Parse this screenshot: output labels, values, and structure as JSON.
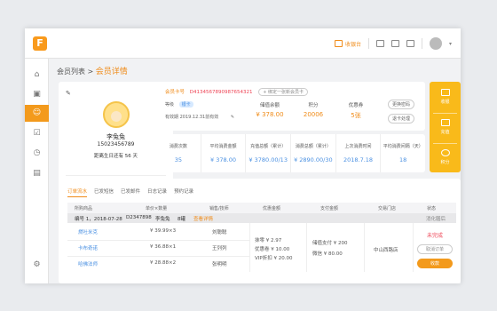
{
  "topbar": {
    "logo": "F",
    "cashier": "收银台"
  },
  "breadcrumb": {
    "parent": "会员列表",
    "sep": ">",
    "current": "会员详情"
  },
  "profile": {
    "name": "李兔兔",
    "phone": "15023456789",
    "note": "距离生日还有 56 天"
  },
  "info": {
    "card_label": "会员卡号",
    "card_number": "D4134567890987654321",
    "bind_tag": "+ 绑定一张新会员卡",
    "level_label": "等级",
    "level": "银卡",
    "expiry_label": "有效期",
    "expiry": "2019.12.31前有效",
    "stats": [
      {
        "label": "储值余额",
        "value": "¥ 378.00"
      },
      {
        "label": "积分",
        "value": "20006"
      },
      {
        "label": "优惠券",
        "value": "5张"
      }
    ],
    "buttons": [
      "更换密码",
      "退卡处理"
    ]
  },
  "stats2": [
    {
      "label": "消费次数",
      "value": "35"
    },
    {
      "label": "平均消费金额",
      "value": "¥ 378.00"
    },
    {
      "label": "充值总额（累计）",
      "value": "¥ 3780.00/13"
    },
    {
      "label": "消费总额（累计）",
      "value": "¥ 2890.00/30"
    },
    {
      "label": "上次消费时间",
      "value": "2018.7.18"
    },
    {
      "label": "平均消费间隔（天）",
      "value": "18"
    }
  ],
  "rightbar": [
    "收银",
    "充值",
    "积分"
  ],
  "tabs": [
    "订单流水",
    "已发短信",
    "已发邮件",
    "日志记录",
    "预约记录"
  ],
  "table": {
    "headers": [
      "所购商品",
      "单价×数量",
      "销售/技师",
      "优惠金额",
      "支付金额",
      "交易门店",
      "状态"
    ],
    "order_no": "编号 1，2018-07-28",
    "order_id": "D2347898",
    "member": "李兔兔",
    "item_count": "8罐",
    "detail": "查看详情",
    "right_tag": "消化膳后",
    "rows": [
      {
        "name": "燃吐米克",
        "price": "¥ 39.99×3",
        "staff": "刘聪聪"
      },
      {
        "name": "卡布奇诺",
        "price": "¥ 36.88×1",
        "staff": "王列列"
      },
      {
        "name": "哈佛法师",
        "price": "¥ 28.88×2",
        "staff": "张明明"
      }
    ],
    "discount": [
      "抹零 ¥ 2.97",
      "优惠卷 ¥ 10.00",
      "VIP折扣 ¥ 20.00"
    ],
    "payment": [
      "储值支付 ¥ 200",
      "微信 ¥ 80.00"
    ],
    "store": "中山西路店",
    "status": "未完成",
    "cancel": "取消订单",
    "pay": "收款"
  }
}
